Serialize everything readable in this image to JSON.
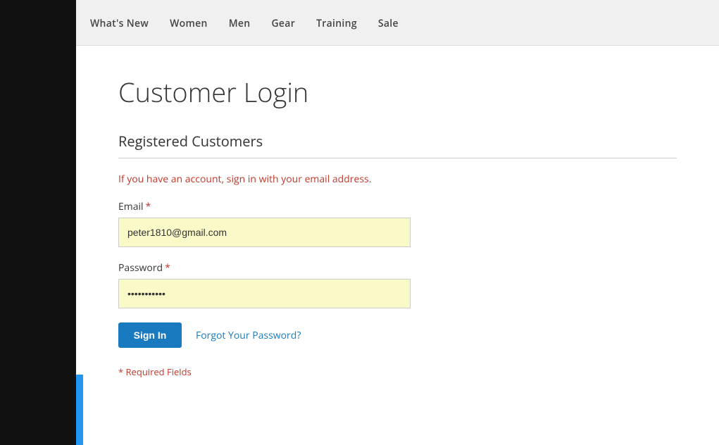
{
  "leftBar": {
    "visible": true
  },
  "nav": {
    "items": [
      {
        "label": "What's New",
        "id": "whats-new"
      },
      {
        "label": "Women",
        "id": "women"
      },
      {
        "label": "Men",
        "id": "men"
      },
      {
        "label": "Gear",
        "id": "gear"
      },
      {
        "label": "Training",
        "id": "training"
      },
      {
        "label": "Sale",
        "id": "sale"
      }
    ]
  },
  "page": {
    "title": "Customer Login",
    "sectionTitle": "Registered Customers",
    "infoText": "If you have an account, sign in with your email address.",
    "emailLabel": "Email",
    "emailValue": "peter1810@gmail.com",
    "emailPlaceholder": "",
    "passwordLabel": "Password",
    "passwordValue": "••••••••••",
    "signInLabel": "Sign In",
    "forgotLabel": "Forgot Your Password?",
    "requiredNote": "* Required Fields"
  }
}
